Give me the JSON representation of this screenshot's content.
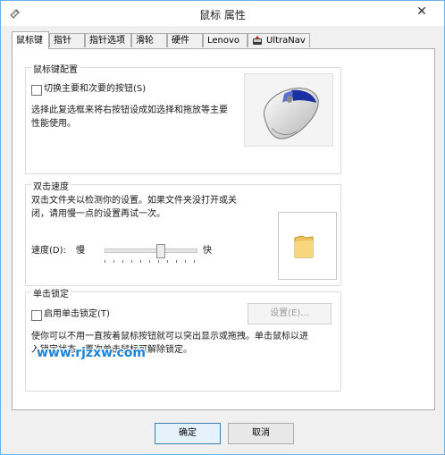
{
  "window": {
    "title": "鼠标 属性",
    "close_glyph": "✕"
  },
  "tabs": [
    {
      "label": "鼠标键",
      "active": true
    },
    {
      "label": "指针"
    },
    {
      "label": "指针选项"
    },
    {
      "label": "滑轮"
    },
    {
      "label": "硬件"
    },
    {
      "label": "Lenovo"
    },
    {
      "label": "UltraNav"
    }
  ],
  "button_config": {
    "heading": "鼠标键配置",
    "checkbox_label": "切换主要和次要的按钮(S)",
    "checked": false,
    "description_line1": "选择此复选框来将右按钮设成如选择和拖放等主要",
    "description_line2": "性能使用。"
  },
  "double_click": {
    "heading": "双击速度",
    "description_line1": "双击文件夹以检测你的设置。如果文件夹没打开或关",
    "description_line2": "闭，请用慢一点的设置再试一次。",
    "speed_label": "速度(D):",
    "slow_label": "慢",
    "fast_label": "快",
    "speed_level": 0.62
  },
  "click_lock": {
    "heading": "单击锁定",
    "checkbox_label": "启用单击锁定(T)",
    "checked": false,
    "settings_button": "设置(E)...",
    "description_line1": "使你可以不用一直按着鼠标按钮就可以突出显示或拖拽。单击鼠标以进",
    "description_line2": "入锁定状态，再次单击鼠标可解除锁定。"
  },
  "watermark": "www.rjzxw.com",
  "footer": {
    "ok": "确定",
    "cancel": "取消"
  }
}
